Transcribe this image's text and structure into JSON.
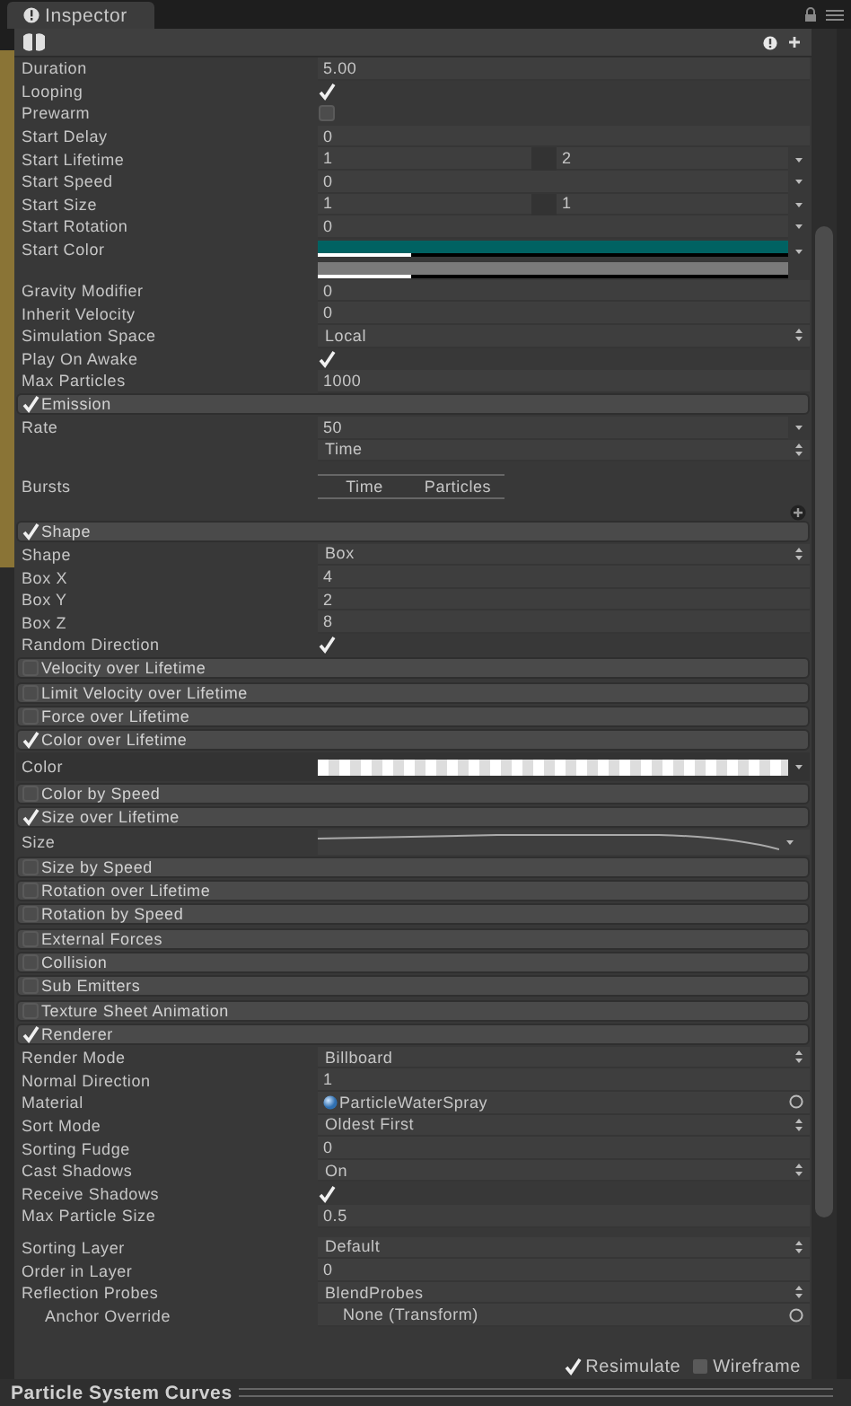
{
  "tab": {
    "label": "Inspector"
  },
  "rows": [
    {
      "kind": "value",
      "label": "Duration",
      "value": "5.00"
    },
    {
      "kind": "check",
      "label": "Looping",
      "checked": true
    },
    {
      "kind": "check",
      "label": "Prewarm",
      "checked": false
    },
    {
      "kind": "value",
      "label": "Start Delay",
      "value": "0"
    },
    {
      "kind": "range",
      "label": "Start Lifetime",
      "value": "1",
      "value2": "2"
    },
    {
      "kind": "curve",
      "label": "Start Speed",
      "value": "0"
    },
    {
      "kind": "range",
      "label": "Start Size",
      "value": "1",
      "value2": "1"
    },
    {
      "kind": "curve",
      "label": "Start Rotation",
      "value": "0"
    },
    {
      "kind": "color",
      "label": "Start Color",
      "color": "#006262"
    },
    {
      "kind": "value",
      "label": "Gravity Modifier",
      "value": "0"
    },
    {
      "kind": "value",
      "label": "Inherit Velocity",
      "value": "0"
    },
    {
      "kind": "dropdown",
      "label": "Simulation Space",
      "value": "Local"
    },
    {
      "kind": "check",
      "label": "Play On Awake",
      "checked": true
    },
    {
      "kind": "value",
      "label": "Max Particles",
      "value": "1000"
    },
    {
      "kind": "module",
      "label": "Emission",
      "enabled": true
    },
    {
      "kind": "curve",
      "label": "Rate",
      "value": "50"
    },
    {
      "kind": "dropdown",
      "value": "Time"
    },
    {
      "kind": "bursts",
      "label": "Bursts",
      "columns": [
        "Time",
        "Particles"
      ]
    },
    {
      "kind": "module",
      "label": "Shape",
      "enabled": true
    },
    {
      "kind": "dropdown",
      "label": "Shape",
      "value": "Box"
    },
    {
      "kind": "value",
      "label": "Box X",
      "value": "4"
    },
    {
      "kind": "value",
      "label": "Box Y",
      "value": "2"
    },
    {
      "kind": "value",
      "label": "Box Z",
      "value": "8"
    },
    {
      "kind": "check",
      "label": "Random Direction",
      "checked": true
    },
    {
      "kind": "module",
      "label": "Velocity over Lifetime",
      "enabled": false
    },
    {
      "kind": "module",
      "label": "Limit Velocity over Lifetime",
      "enabled": false
    },
    {
      "kind": "module",
      "label": "Force over Lifetime",
      "enabled": false
    },
    {
      "kind": "module",
      "label": "Color over Lifetime",
      "enabled": true
    },
    {
      "kind": "gradient",
      "label": "Color"
    },
    {
      "kind": "module",
      "label": "Color by Speed",
      "enabled": false
    },
    {
      "kind": "module",
      "label": "Size over Lifetime",
      "enabled": true
    },
    {
      "kind": "sizecurve",
      "label": "Size"
    },
    {
      "kind": "module",
      "label": "Size by Speed",
      "enabled": false
    },
    {
      "kind": "module",
      "label": "Rotation over Lifetime",
      "enabled": false
    },
    {
      "kind": "module",
      "label": "Rotation by Speed",
      "enabled": false
    },
    {
      "kind": "module",
      "label": "External Forces",
      "enabled": false
    },
    {
      "kind": "module",
      "label": "Collision",
      "enabled": false
    },
    {
      "kind": "module",
      "label": "Sub Emitters",
      "enabled": false
    },
    {
      "kind": "module",
      "label": "Texture Sheet Animation",
      "enabled": false
    },
    {
      "kind": "module",
      "label": "Renderer",
      "enabled": true
    },
    {
      "kind": "dropdown",
      "label": "Render Mode",
      "value": "Billboard"
    },
    {
      "kind": "value",
      "label": "Normal Direction",
      "value": "1"
    },
    {
      "kind": "asset",
      "label": "Material",
      "value": "ParticleWaterSpray"
    },
    {
      "kind": "dropdown",
      "label": "Sort Mode",
      "value": "Oldest First"
    },
    {
      "kind": "value",
      "label": "Sorting Fudge",
      "value": "0"
    },
    {
      "kind": "dropdown",
      "label": "Cast Shadows",
      "value": "On"
    },
    {
      "kind": "check",
      "label": "Receive Shadows",
      "checked": true
    },
    {
      "kind": "value",
      "label": "Max Particle Size",
      "value": "0.5"
    },
    {
      "kind": "spacer"
    },
    {
      "kind": "dropdown",
      "label": "Sorting Layer",
      "value": "Default"
    },
    {
      "kind": "value",
      "label": "Order in Layer",
      "value": "0"
    },
    {
      "kind": "dropdown",
      "label": "Reflection Probes",
      "value": "BlendProbes"
    },
    {
      "kind": "object",
      "label": "Anchor Override",
      "value": "None (Transform)",
      "indented": true
    }
  ],
  "footer": {
    "options": [
      {
        "label": "Resimulate",
        "checked": true
      },
      {
        "label": "Wireframe",
        "checked": false
      }
    ]
  },
  "curves_bar": {
    "title": "Particle System Curves"
  }
}
